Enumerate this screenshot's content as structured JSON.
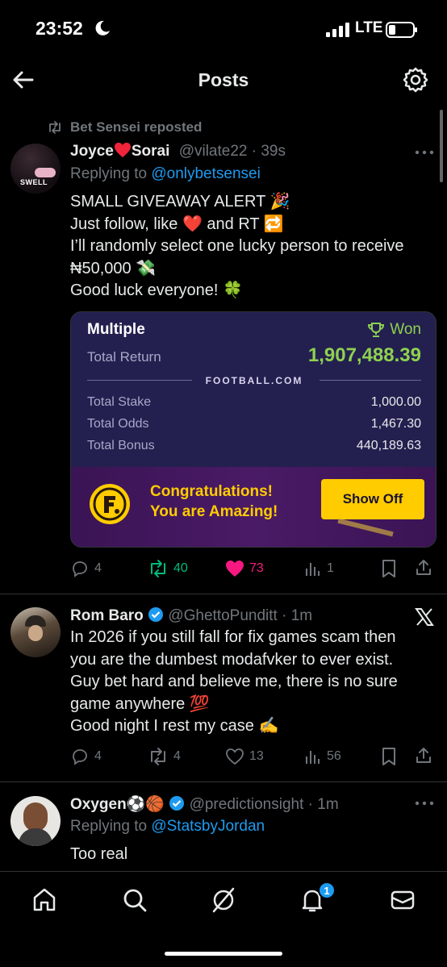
{
  "status_bar": {
    "time": "23:52",
    "network": "LTE"
  },
  "header": {
    "title": "Posts"
  },
  "posts": [
    {
      "repost_label": "Bet Sensei reposted",
      "avatar_text": "SWELL",
      "name_part1": "Joyce",
      "name_part2": "Sorai",
      "handle": "@vilate22",
      "time": "39s",
      "replying_prefix": "Replying to",
      "replying_to": "@onlybetsensei",
      "lines": [
        "SMALL GIVEAWAY ALERT 🎉",
        "Just follow, like ❤️ and RT 🔁",
        "I’ll randomly select one lucky person to receive",
        "₦50,000 💸",
        "Good luck everyone! 🍀"
      ],
      "bet_card": {
        "type": "Multiple",
        "status": "Won",
        "total_return_label": "Total Return",
        "total_return": "1,907,488.39",
        "brand": "FOOTBALL.COM",
        "rows": [
          {
            "label": "Total Stake",
            "value": "1,000.00"
          },
          {
            "label": "Total Odds",
            "value": "1,467.30"
          },
          {
            "label": "Total Bonus",
            "value": "440,189.63"
          }
        ],
        "banner_line1": "Congratulations!",
        "banner_line2": "You are Amazing!",
        "show_off": "Show Off"
      },
      "stats": {
        "replies": "4",
        "reposts": "40",
        "likes": "73",
        "views": "1"
      }
    },
    {
      "name": "Rom Baro",
      "handle": "@GhettoPunditt",
      "time": "1m",
      "lines": [
        "In 2026 if you still fall for fix games scam then",
        "you are the dumbest modafvker to ever exist.",
        "Guy bet hard and believe me, there is no sure",
        "game anywhere 💯",
        "Good night I rest my case ✍️"
      ],
      "stats": {
        "replies": "4",
        "reposts": "4",
        "likes": "13",
        "views": "56"
      }
    },
    {
      "name": "Oxygen⚽🏀",
      "handle": "@predictionsight",
      "time": "1m",
      "replying_prefix": "Replying to",
      "replying_to": "@StatsbyJordan",
      "lines": [
        "Too real"
      ]
    }
  ],
  "bottom_nav": {
    "notification_count": "1"
  },
  "colors": {
    "accent": "#1d9bf0",
    "like": "#f91880",
    "repost": "#00ba7c",
    "won": "#8fd14f",
    "show_off": "#ffcc00"
  }
}
